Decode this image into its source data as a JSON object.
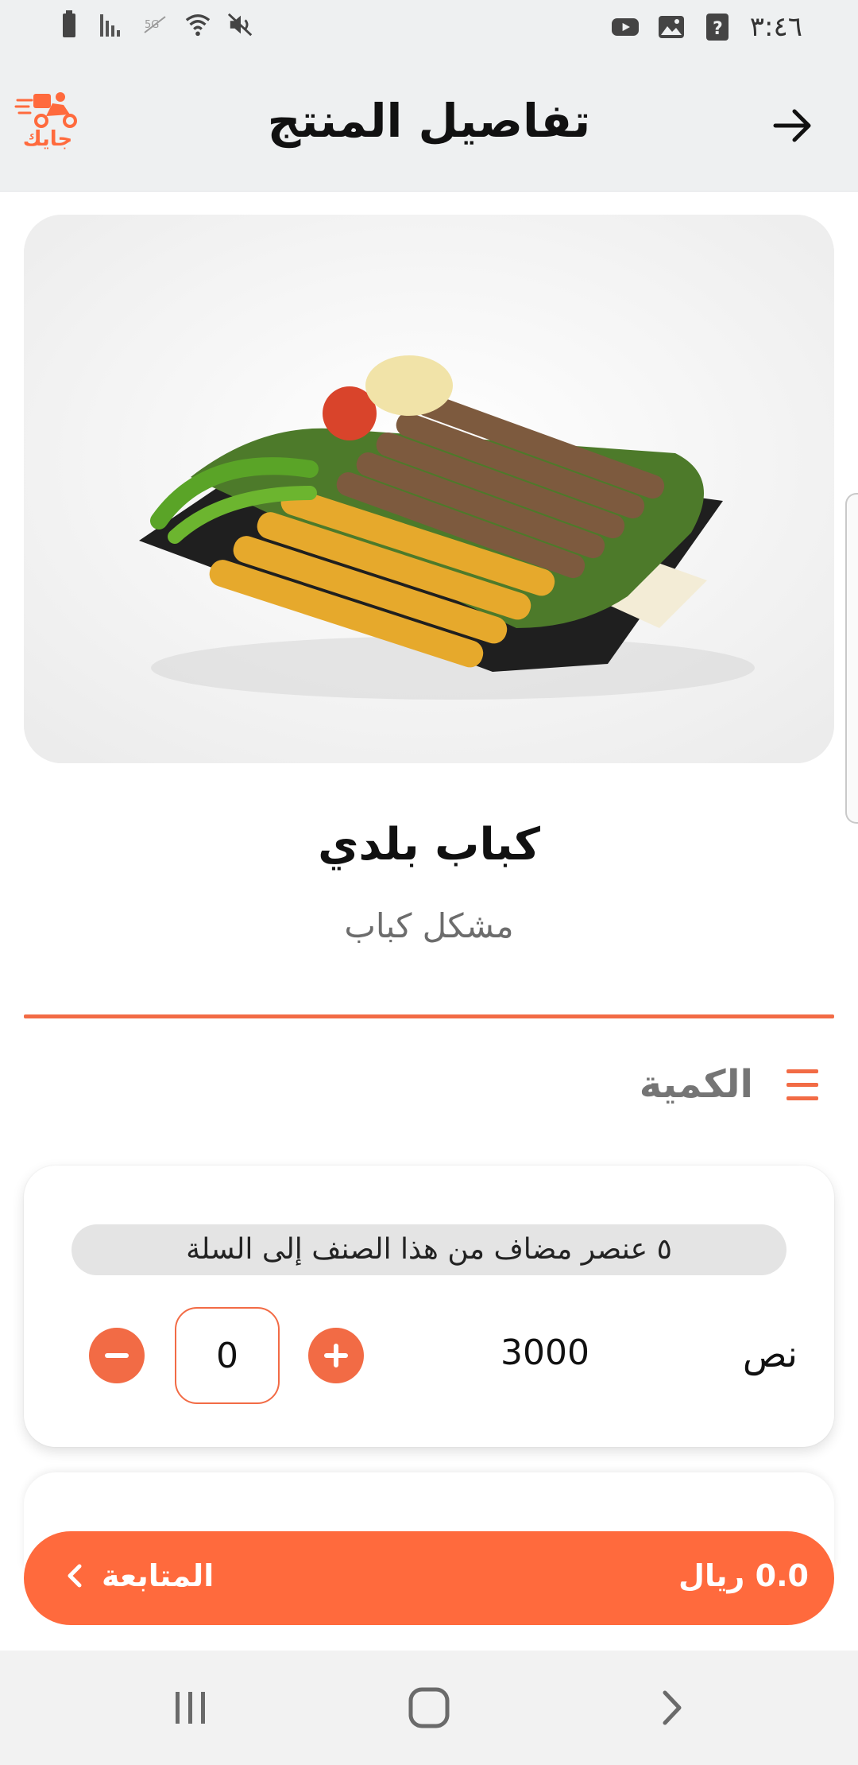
{
  "status_bar": {
    "time": "٣:٤٦",
    "icons": [
      "battery-icon",
      "signal-icon",
      "5g-off-icon",
      "wifi-icon",
      "mute-icon",
      "youtube-icon",
      "gallery-icon",
      "question-icon"
    ]
  },
  "app_bar": {
    "title": "تفاصيل المنتج",
    "logo_text": "جايك",
    "back_icon": "arrow-right-icon"
  },
  "product": {
    "name": "كباب بلدي",
    "category": "مشكل كباب"
  },
  "quantity_section": {
    "title": "الكمية",
    "icon": "numbered-list-icon"
  },
  "option_card": {
    "cart_status": "٥ عنصر مضاف من هذا الصنف إلى السلة",
    "size_label": "نص",
    "price": "3000",
    "quantity": "0"
  },
  "footer": {
    "total": "0.0 ريال",
    "proceed_label": "المتابعة"
  },
  "colors": {
    "accent": "#f26b45",
    "proceed_bg": "#ff6a3d",
    "app_bar_bg": "#eef0f1"
  }
}
